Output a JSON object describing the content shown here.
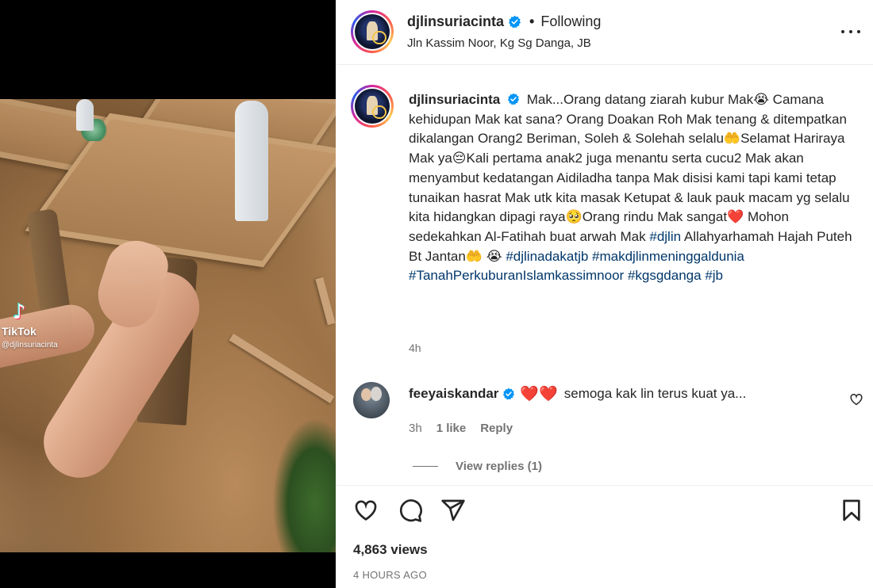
{
  "media": {
    "watermark_brand": "TikTok",
    "watermark_user": "@djlinsuriacinta"
  },
  "post": {
    "username": "djlinsuriacinta",
    "separator": "•",
    "follow_status": "Following",
    "location": "Jln Kassim Noor, Kg Sg Danga, JB"
  },
  "caption": {
    "username": "djlinsuriacinta",
    "text": "Mak...Orang datang ziarah kubur Mak😭 Camana kehidupan Mak kat sana? Orang Doakan Roh Mak tenang & ditempatkan dikalangan Orang2 Beriman, Soleh & Solehah selalu🤲Selamat Hariraya Mak ya😔Kali pertama anak2 juga menantu serta cucu2 Mak akan menyambut kedatangan Aidiladha tanpa Mak disisi kami tapi kami tetap tunaikan hasrat Mak utk kita masak Ketupat & lauk pauk macam yg selalu kita hidangkan dipagi raya🥺Orang rindu Mak sangat❤️ Mohon sedekahkan Al-Fatihah buat arwah Mak",
    "hashtags": [
      "#djlin",
      "#djlinadakatjb",
      "#makdjlinmeninggaldunia",
      "#TanahPerkuburanIslamkassimnoor",
      "#kgsgdanga",
      "#jb"
    ],
    "mid_text": "Allahyarhamah Hajah Puteh Bt Jantan🤲 😭",
    "time": "4h"
  },
  "comment": {
    "username": "feeyaiskandar",
    "hearts": "❤️❤️",
    "text": "semoga kak lin terus kuat ya...",
    "time": "3h",
    "likes": "1 like",
    "reply_label": "Reply",
    "view_replies": "View replies (1)"
  },
  "footer": {
    "views": "4,863 views",
    "timestamp": "4 HOURS AGO"
  },
  "icons": {
    "verified": "verified-badge-icon",
    "more": "more-options-icon",
    "like": "heart-outline-icon",
    "comment": "comment-bubble-icon",
    "share": "paper-plane-icon",
    "save": "bookmark-outline-icon"
  },
  "colors": {
    "verified_blue": "#0095f6",
    "hashtag_blue": "#00376b",
    "muted_gray": "#737373",
    "heart_red": "#e8172c"
  }
}
